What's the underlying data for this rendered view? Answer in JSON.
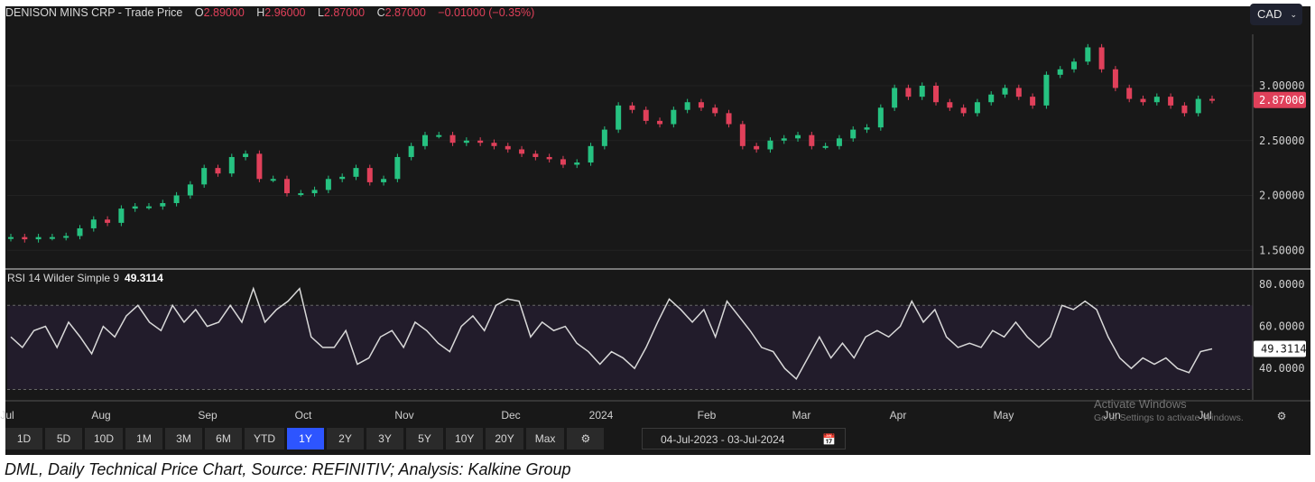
{
  "header": {
    "symbol": "DENISON MINS CRP",
    "dot": " - ",
    "series": "Trade Price",
    "o_label": "O",
    "o": "2.89000",
    "h_label": "H",
    "h": "2.96000",
    "l_label": "L",
    "l": "2.87000",
    "c_label": "C",
    "c": "2.87000",
    "change": "−0.01000 (−0.35%)"
  },
  "currency": {
    "value": "CAD",
    "chevron": "⌄"
  },
  "rsi_header": {
    "label": "RSI 14 Wilder Simple 9",
    "value": "49.3114"
  },
  "range_buttons": [
    "1D",
    "5D",
    "10D",
    "1M",
    "3M",
    "6M",
    "YTD",
    "1Y",
    "2Y",
    "3Y",
    "5Y",
    "10Y",
    "20Y",
    "Max"
  ],
  "active_range": "1Y",
  "date_range": {
    "from": "04-Jul-2023",
    "sep": "-",
    "to": "03-Jul-2024"
  },
  "watermark": {
    "line1": "Activate Windows",
    "line2": "Go to Settings to activate Windows."
  },
  "caption": "DML, Daily Technical Price Chart, Source: REFINITIV; Analysis: Kalkine Group",
  "colors": {
    "up": "#26c281",
    "down": "#e0405a",
    "rsi_line": "#d9d9d9",
    "rsi_band": "#221c2b",
    "bg": "#181818",
    "active": "#2d55ff"
  },
  "chart_data": [
    {
      "type": "candlestick",
      "title": "DENISON MINS CRP - Trade Price",
      "ylim": [
        1.4,
        3.45
      ],
      "y_ticks": [
        "1.50000",
        "2.00000",
        "2.50000",
        "3.00000"
      ],
      "y_tick_values": [
        1.5,
        2.0,
        2.5,
        3.0
      ],
      "last_price_label": "2.87000",
      "last_price": 2.87,
      "x_ticks": [
        "Jul",
        "Aug",
        "Sep",
        "Oct",
        "Nov",
        "Dec",
        "2024",
        "Feb",
        "Mar",
        "Apr",
        "May",
        "Jun",
        "Jul"
      ],
      "closes": [
        1.62,
        1.6,
        1.62,
        1.62,
        1.63,
        1.7,
        1.78,
        1.75,
        1.88,
        1.9,
        1.9,
        1.93,
        2.0,
        2.1,
        2.25,
        2.2,
        2.35,
        2.38,
        2.15,
        2.15,
        2.02,
        2.02,
        2.05,
        2.15,
        2.17,
        2.25,
        2.12,
        2.15,
        2.35,
        2.45,
        2.55,
        2.55,
        2.48,
        2.5,
        2.48,
        2.45,
        2.42,
        2.38,
        2.35,
        2.33,
        2.28,
        2.3,
        2.45,
        2.6,
        2.82,
        2.78,
        2.68,
        2.65,
        2.78,
        2.85,
        2.8,
        2.75,
        2.65,
        2.45,
        2.42,
        2.5,
        2.52,
        2.55,
        2.45,
        2.45,
        2.52,
        2.6,
        2.62,
        2.8,
        2.98,
        2.9,
        3.0,
        2.85,
        2.8,
        2.75,
        2.85,
        2.92,
        2.98,
        2.9,
        2.82,
        3.1,
        3.15,
        3.22,
        3.35,
        3.15,
        2.98,
        2.88,
        2.85,
        2.9,
        2.82,
        2.75,
        2.88,
        2.87
      ]
    },
    {
      "type": "line",
      "title": "RSI 14 Wilder Simple 9",
      "ylim": [
        25,
        85
      ],
      "y_ticks": [
        "40.0000",
        "60.0000",
        "80.0000"
      ],
      "y_tick_values": [
        40,
        60,
        80
      ],
      "bands": [
        30,
        70
      ],
      "last_value_label": "49.3114",
      "values": [
        55,
        50,
        58,
        60,
        50,
        62,
        55,
        47,
        60,
        55,
        65,
        70,
        62,
        58,
        70,
        62,
        68,
        60,
        62,
        70,
        62,
        78,
        62,
        68,
        72,
        78,
        55,
        50,
        50,
        58,
        42,
        45,
        55,
        58,
        50,
        62,
        58,
        52,
        48,
        60,
        65,
        58,
        70,
        73,
        72,
        55,
        62,
        58,
        60,
        52,
        48,
        42,
        48,
        45,
        40,
        50,
        62,
        73,
        68,
        62,
        68,
        55,
        72,
        65,
        58,
        50,
        48,
        40,
        35,
        45,
        55,
        45,
        52,
        45,
        55,
        58,
        55,
        60,
        72,
        62,
        68,
        55,
        50,
        52,
        50,
        58,
        55,
        62,
        55,
        50,
        55,
        70,
        68,
        72,
        68,
        55,
        45,
        40,
        45,
        42,
        45,
        40,
        38,
        48,
        49.3
      ]
    }
  ]
}
